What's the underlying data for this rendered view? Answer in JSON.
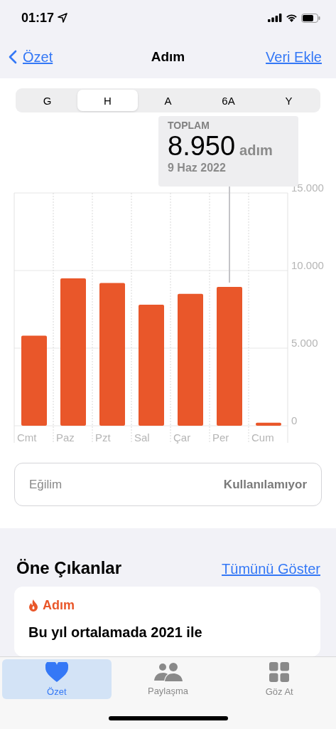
{
  "status_bar": {
    "time": "01:17"
  },
  "nav": {
    "back": "Özet",
    "title": "Adım",
    "action": "Veri Ekle"
  },
  "segments": [
    {
      "label": "G",
      "selected": false
    },
    {
      "label": "H",
      "selected": true
    },
    {
      "label": "A",
      "selected": false
    },
    {
      "label": "6A",
      "selected": false
    },
    {
      "label": "Y",
      "selected": false
    }
  ],
  "tooltip": {
    "label": "TOPLAM",
    "value": "8.950",
    "unit": "adım",
    "date": "9 Haz 2022"
  },
  "chart": {
    "chart_data": {
      "type": "bar",
      "categories": [
        "Cmt",
        "Paz",
        "Pzt",
        "Sal",
        "Çar",
        "Per",
        "Cum"
      ],
      "series": [
        {
          "color": "#e9572a",
          "values": [
            5800,
            9500,
            9200,
            7800,
            8500,
            8950,
            200
          ]
        }
      ],
      "ylim": [
        0,
        15000
      ],
      "yticks": [
        {
          "value": 0,
          "label": "0"
        },
        {
          "value": 5000,
          "label": "5.000"
        },
        {
          "value": 10000,
          "label": "10.000"
        },
        {
          "value": 15000,
          "label": "15.000"
        }
      ]
    }
  },
  "trend": {
    "label": "Eğilim",
    "value": "Kullanılamıyor"
  },
  "highlights": {
    "title": "Öne Çıkanlar",
    "link": "Tümünü Göster",
    "card": {
      "category": "Adım",
      "text": "Bu yıl ortalamada 2021 ile"
    }
  },
  "tab_bar": [
    {
      "label": "Özet",
      "selected": true
    },
    {
      "label": "Paylaşma",
      "selected": false
    },
    {
      "label": "Göz At",
      "selected": false
    }
  ]
}
